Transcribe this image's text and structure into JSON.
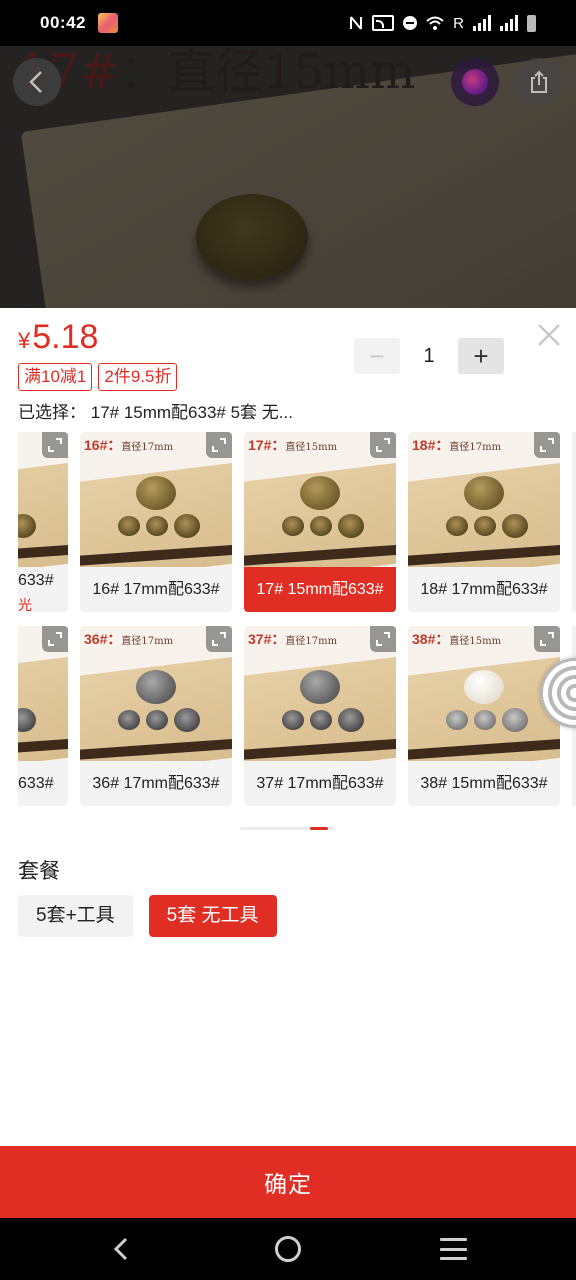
{
  "status_bar": {
    "time": "00:42",
    "roaming": "R",
    "icons": [
      "app-icon",
      "nfc-icon",
      "cast-icon",
      "dnd-icon",
      "wifi-icon",
      "signal-icon",
      "signal-icon",
      "battery-icon"
    ]
  },
  "hero": {
    "overlay_code": "17#",
    "overlay_text": "：直径15mm",
    "icons": [
      "back-arrow-icon",
      "avatar-icon",
      "share-icon"
    ]
  },
  "product": {
    "currency": "¥",
    "price": "5.18",
    "promo_tags": [
      "满10减1",
      "2件9.5折"
    ],
    "quantity": "1",
    "minus_label": "−",
    "plus_label": "+",
    "selected_label": "已选择：",
    "selected_value": "17# 15mm配633# 5套 无..."
  },
  "variants": {
    "partial_left": [
      {
        "caption": "633#",
        "sub": "光"
      },
      {
        "caption": "633#"
      }
    ],
    "row1": [
      {
        "code": "16#",
        "desc": "直径17mm",
        "caption": "16# 17mm配633#",
        "metal": "brass",
        "selected": false
      },
      {
        "code": "17#",
        "desc": "直径15mm",
        "caption": "17# 15mm配633#",
        "metal": "brass",
        "selected": true
      },
      {
        "code": "18#",
        "desc": "直径17mm",
        "caption": "18# 17mm配633#",
        "metal": "brass",
        "selected": false
      }
    ],
    "row2": [
      {
        "code": "36#",
        "desc": "直径17mm",
        "caption": "36# 17mm配633#",
        "metal": "silver",
        "selected": false
      },
      {
        "code": "37#",
        "desc": "直径17mm",
        "caption": "37# 17mm配633#",
        "metal": "silver",
        "selected": false
      },
      {
        "code": "38#",
        "desc": "直径15mm",
        "caption": "38# 15mm配633#",
        "metal": "bright",
        "selected": false
      }
    ],
    "page_indicator": {
      "pages": 2,
      "current": 2
    }
  },
  "package": {
    "title": "套餐",
    "options": [
      {
        "label": "5套+工具",
        "active": false
      },
      {
        "label": "5套 无工具",
        "active": true
      }
    ]
  },
  "confirm_label": "确定",
  "colors": {
    "accent": "#e02e24",
    "sheet_bg": "#ffffff"
  }
}
